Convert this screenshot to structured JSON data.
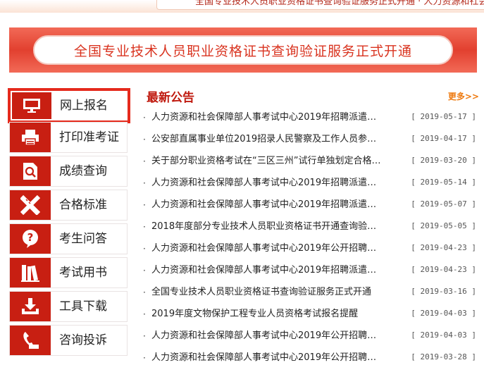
{
  "header": {
    "marquee": "全国专业技术人员职业资格证书查询验证服务正式开通 · 人力资源和社会保障部人事考试中心"
  },
  "banner": {
    "text": "全国专业技术人员职业资格证书查询验证服务正式开通"
  },
  "sidebar": {
    "items": [
      {
        "label": "网上报名",
        "icon": "monitor-icon"
      },
      {
        "label": "打印准考证",
        "icon": "printer-icon"
      },
      {
        "label": "成绩查询",
        "icon": "search-document-icon"
      },
      {
        "label": "合格标准",
        "icon": "ruler-pencil-icon"
      },
      {
        "label": "考生问答",
        "icon": "question-bubble-icon"
      },
      {
        "label": "考试用书",
        "icon": "books-icon"
      },
      {
        "label": "工具下载",
        "icon": "download-tray-icon"
      },
      {
        "label": "咨询投诉",
        "icon": "telephone-icon"
      }
    ]
  },
  "news": {
    "title": "最新公告",
    "more": "更多>>",
    "items": [
      {
        "text": "人力资源和社会保障部人事考试中心2019年招聘派遣…",
        "date": "[ 2019-05-17 ]"
      },
      {
        "text": "公安部直属事业单位2019招录人民警察及工作人员参…",
        "date": "[ 2019-04-17 ]"
      },
      {
        "text": "关于部分职业资格考试在“三区三州”试行单独划定合格…",
        "date": "[ 2019-03-20 ]"
      },
      {
        "text": "人力资源和社会保障部人事考试中心2019年招聘派遣…",
        "date": "[ 2019-05-14 ]"
      },
      {
        "text": "人力资源和社会保障部人事考试中心2019年招聘派遣…",
        "date": "[ 2019-05-07 ]"
      },
      {
        "text": "2018年度部分专业技术人员职业资格证书开通查询验…",
        "date": "[ 2019-05-05 ]"
      },
      {
        "text": "人力资源和社会保障部人事考试中心2019年公开招聘…",
        "date": "[ 2019-04-23 ]"
      },
      {
        "text": "人力资源和社会保障部人事考试中心2019年招聘派遣…",
        "date": "[ 2019-04-23 ]"
      },
      {
        "text": "全国专业技术人员职业资格证书查询验证服务正式开通",
        "date": "[ 2019-03-16 ]"
      },
      {
        "text": "2019年度文物保护工程专业人员资格考试报名提醒",
        "date": "[ 2019-04-03 ]"
      },
      {
        "text": "人力资源和社会保障部人事考试中心2019年公开招聘…",
        "date": "[ 2019-04-03 ]"
      },
      {
        "text": "人力资源和社会保障部人事考试中心2019年公开招聘…",
        "date": "[ 2019-03-28 ]"
      }
    ]
  },
  "colors": {
    "brand_red": "#c81f12",
    "banner_red": "#e2402f",
    "more_orange": "#ee7a10"
  }
}
